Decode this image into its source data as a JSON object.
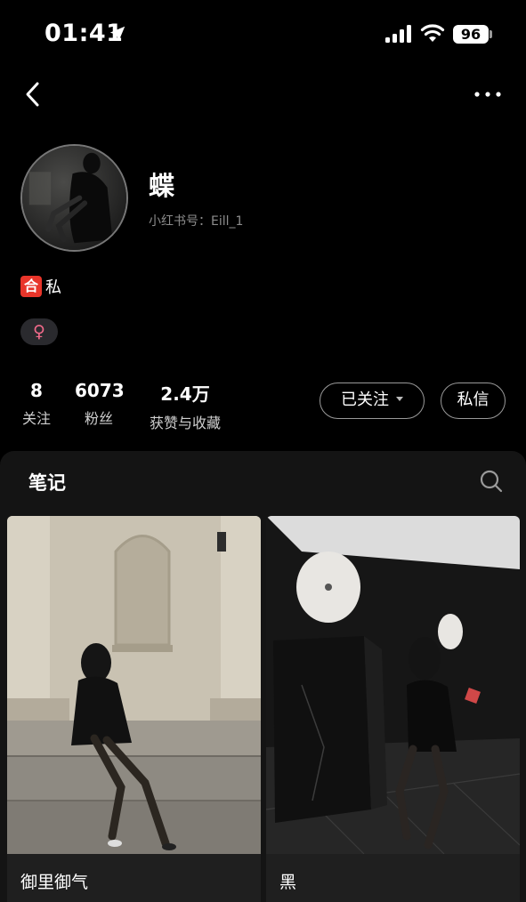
{
  "status_bar": {
    "time": "01:41",
    "battery": "96"
  },
  "profile": {
    "name": "蝶",
    "redbook_id": "小红书号：Eill_1",
    "bio_emoji": "合",
    "bio_text": "私",
    "gender_symbol": "♀"
  },
  "stats": [
    {
      "value": "8",
      "label": "关注"
    },
    {
      "value": "6073",
      "label": "粉丝"
    },
    {
      "value": "2.4万",
      "label": "获赞与收藏"
    }
  ],
  "actions": {
    "follow_label": "已关注",
    "message_label": "私信"
  },
  "notes": {
    "tab_label": "笔记",
    "cards": [
      {
        "title": "御里御气"
      },
      {
        "title": "黑"
      }
    ]
  },
  "icons": [
    "location-arrow-icon",
    "signal-icon",
    "wifi-icon",
    "battery-icon",
    "back-icon",
    "more-icon",
    "search-icon"
  ],
  "colors": {
    "background": "#000000",
    "panel": "#141414",
    "bio_emoji_bg": "#e8352a",
    "gender_symbol": "#f06a8a"
  }
}
